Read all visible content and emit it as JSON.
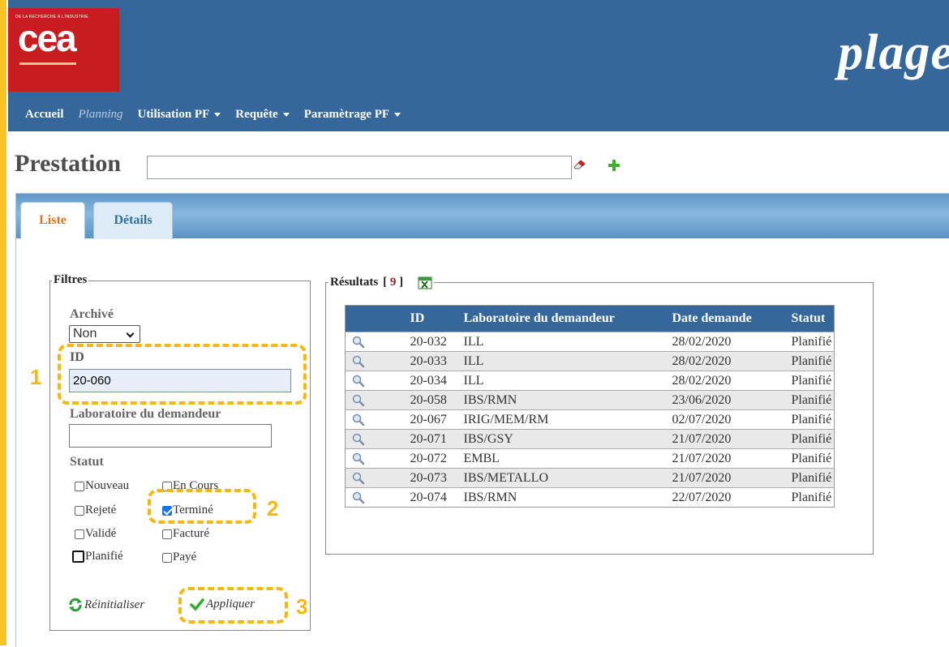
{
  "header": {
    "logo_tagline": "DE LA RECHERCHE À L'INDUSTRIE",
    "logo_text": "cea",
    "brand": "plage"
  },
  "nav": {
    "items": [
      {
        "label": "Accueil",
        "dropdown": false
      },
      {
        "label": "Planning",
        "dropdown": false
      },
      {
        "label": "Utilisation PF",
        "dropdown": true
      },
      {
        "label": "Requête",
        "dropdown": true
      },
      {
        "label": "Paramètrage PF",
        "dropdown": true
      }
    ]
  },
  "prestation": {
    "label": "Prestation",
    "value": ""
  },
  "tabs": [
    {
      "label": "Liste",
      "active": true
    },
    {
      "label": "Détails",
      "active": false
    }
  ],
  "filters": {
    "legend": "Filtres",
    "archive_label": "Archivé",
    "archive_value": "Non",
    "id_label": "ID",
    "id_value": "20-060",
    "lab_label": "Laboratoire du demandeur",
    "lab_value": "",
    "statut_label": "Statut",
    "statuses": [
      {
        "label": "Nouveau",
        "checked": false
      },
      {
        "label": "En Cours",
        "checked": false
      },
      {
        "label": "Rejeté",
        "checked": false
      },
      {
        "label": "Terminé",
        "checked": true
      },
      {
        "label": "Validé",
        "checked": false
      },
      {
        "label": "Facturé",
        "checked": false
      },
      {
        "label": "Planifié",
        "checked": false
      },
      {
        "label": "Payé",
        "checked": false
      }
    ],
    "reset_label": "Réinitialiser",
    "apply_label": "Appliquer"
  },
  "results": {
    "legend": "Résultats",
    "count": "9",
    "columns": [
      "",
      "ID",
      "Laboratoire du demandeur",
      "Date demande",
      "Statut"
    ],
    "rows": [
      {
        "id": "20-032",
        "lab": "ILL",
        "date": "28/02/2020",
        "statut": "Planifié"
      },
      {
        "id": "20-033",
        "lab": "ILL",
        "date": "28/02/2020",
        "statut": "Planifié"
      },
      {
        "id": "20-034",
        "lab": "ILL",
        "date": "28/02/2020",
        "statut": "Planifié"
      },
      {
        "id": "20-058",
        "lab": "IBS/RMN",
        "date": "23/06/2020",
        "statut": "Planifié"
      },
      {
        "id": "20-067",
        "lab": "IRIG/MEM/RM",
        "date": "02/07/2020",
        "statut": "Planifié"
      },
      {
        "id": "20-071",
        "lab": "IBS/GSY",
        "date": "21/07/2020",
        "statut": "Planifié"
      },
      {
        "id": "20-072",
        "lab": "EMBL",
        "date": "21/07/2020",
        "statut": "Planifié"
      },
      {
        "id": "20-073",
        "lab": "IBS/METALLO",
        "date": "21/07/2020",
        "statut": "Planifié"
      },
      {
        "id": "20-074",
        "lab": "IBS/RMN",
        "date": "22/07/2020",
        "statut": "Planifié"
      }
    ]
  },
  "annotations": [
    "1",
    "2",
    "3"
  ],
  "colors": {
    "header_bg": "#35679b",
    "logo_red": "#c81c21",
    "annotation": "#f5b80f",
    "active_tab": "#e2711b"
  }
}
